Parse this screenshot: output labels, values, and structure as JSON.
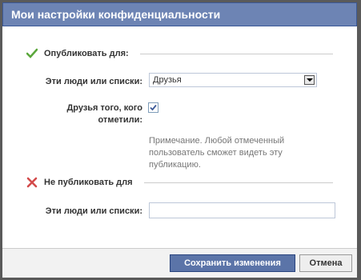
{
  "dialog": {
    "title": "Мои настройки конфиденциальности"
  },
  "publish_section": {
    "heading": "Опубликовать для:",
    "icon": "check-icon",
    "people_label": "Эти люди или списки:",
    "select_value": "Друзья",
    "tagged_friends_label_line1": "Друзья того, кого",
    "tagged_friends_label_line2": "отметили:",
    "tagged_friends_checked": true,
    "note": "Примечание. Любой отмеченный пользователь сможет видеть эту публикацию."
  },
  "hide_section": {
    "heading": "Не публиковать для",
    "icon": "x-icon",
    "people_label": "Эти люди или списки:",
    "input_value": ""
  },
  "footer": {
    "save_label": "Сохранить изменения",
    "cancel_label": "Отмена"
  },
  "colors": {
    "header_bg": "#6d84b4",
    "primary_button": "#5b74a8",
    "check_green": "#5aa73b",
    "x_red": "#d34b4b"
  }
}
